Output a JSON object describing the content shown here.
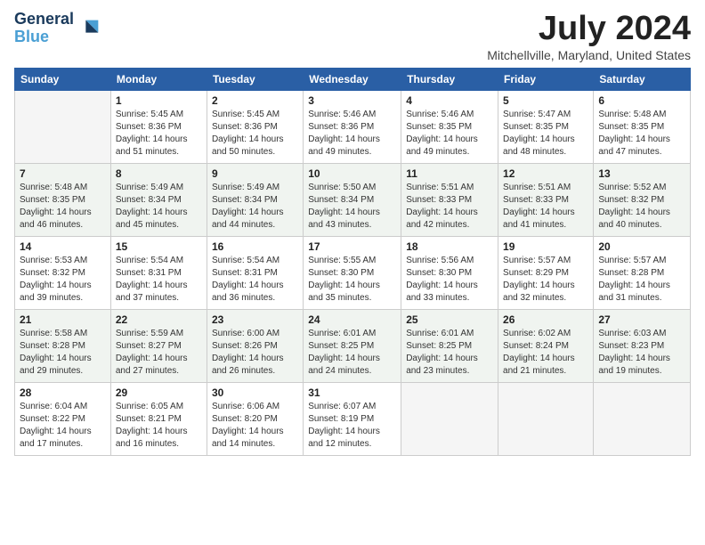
{
  "logo": {
    "line1": "General",
    "line2": "Blue"
  },
  "title": "July 2024",
  "location": "Mitchellville, Maryland, United States",
  "days_of_week": [
    "Sunday",
    "Monday",
    "Tuesday",
    "Wednesday",
    "Thursday",
    "Friday",
    "Saturday"
  ],
  "weeks": [
    [
      {
        "day": "",
        "info": ""
      },
      {
        "day": "1",
        "info": "Sunrise: 5:45 AM\nSunset: 8:36 PM\nDaylight: 14 hours\nand 51 minutes."
      },
      {
        "day": "2",
        "info": "Sunrise: 5:45 AM\nSunset: 8:36 PM\nDaylight: 14 hours\nand 50 minutes."
      },
      {
        "day": "3",
        "info": "Sunrise: 5:46 AM\nSunset: 8:36 PM\nDaylight: 14 hours\nand 49 minutes."
      },
      {
        "day": "4",
        "info": "Sunrise: 5:46 AM\nSunset: 8:35 PM\nDaylight: 14 hours\nand 49 minutes."
      },
      {
        "day": "5",
        "info": "Sunrise: 5:47 AM\nSunset: 8:35 PM\nDaylight: 14 hours\nand 48 minutes."
      },
      {
        "day": "6",
        "info": "Sunrise: 5:48 AM\nSunset: 8:35 PM\nDaylight: 14 hours\nand 47 minutes."
      }
    ],
    [
      {
        "day": "7",
        "info": "Sunrise: 5:48 AM\nSunset: 8:35 PM\nDaylight: 14 hours\nand 46 minutes."
      },
      {
        "day": "8",
        "info": "Sunrise: 5:49 AM\nSunset: 8:34 PM\nDaylight: 14 hours\nand 45 minutes."
      },
      {
        "day": "9",
        "info": "Sunrise: 5:49 AM\nSunset: 8:34 PM\nDaylight: 14 hours\nand 44 minutes."
      },
      {
        "day": "10",
        "info": "Sunrise: 5:50 AM\nSunset: 8:34 PM\nDaylight: 14 hours\nand 43 minutes."
      },
      {
        "day": "11",
        "info": "Sunrise: 5:51 AM\nSunset: 8:33 PM\nDaylight: 14 hours\nand 42 minutes."
      },
      {
        "day": "12",
        "info": "Sunrise: 5:51 AM\nSunset: 8:33 PM\nDaylight: 14 hours\nand 41 minutes."
      },
      {
        "day": "13",
        "info": "Sunrise: 5:52 AM\nSunset: 8:32 PM\nDaylight: 14 hours\nand 40 minutes."
      }
    ],
    [
      {
        "day": "14",
        "info": "Sunrise: 5:53 AM\nSunset: 8:32 PM\nDaylight: 14 hours\nand 39 minutes."
      },
      {
        "day": "15",
        "info": "Sunrise: 5:54 AM\nSunset: 8:31 PM\nDaylight: 14 hours\nand 37 minutes."
      },
      {
        "day": "16",
        "info": "Sunrise: 5:54 AM\nSunset: 8:31 PM\nDaylight: 14 hours\nand 36 minutes."
      },
      {
        "day": "17",
        "info": "Sunrise: 5:55 AM\nSunset: 8:30 PM\nDaylight: 14 hours\nand 35 minutes."
      },
      {
        "day": "18",
        "info": "Sunrise: 5:56 AM\nSunset: 8:30 PM\nDaylight: 14 hours\nand 33 minutes."
      },
      {
        "day": "19",
        "info": "Sunrise: 5:57 AM\nSunset: 8:29 PM\nDaylight: 14 hours\nand 32 minutes."
      },
      {
        "day": "20",
        "info": "Sunrise: 5:57 AM\nSunset: 8:28 PM\nDaylight: 14 hours\nand 31 minutes."
      }
    ],
    [
      {
        "day": "21",
        "info": "Sunrise: 5:58 AM\nSunset: 8:28 PM\nDaylight: 14 hours\nand 29 minutes."
      },
      {
        "day": "22",
        "info": "Sunrise: 5:59 AM\nSunset: 8:27 PM\nDaylight: 14 hours\nand 27 minutes."
      },
      {
        "day": "23",
        "info": "Sunrise: 6:00 AM\nSunset: 8:26 PM\nDaylight: 14 hours\nand 26 minutes."
      },
      {
        "day": "24",
        "info": "Sunrise: 6:01 AM\nSunset: 8:25 PM\nDaylight: 14 hours\nand 24 minutes."
      },
      {
        "day": "25",
        "info": "Sunrise: 6:01 AM\nSunset: 8:25 PM\nDaylight: 14 hours\nand 23 minutes."
      },
      {
        "day": "26",
        "info": "Sunrise: 6:02 AM\nSunset: 8:24 PM\nDaylight: 14 hours\nand 21 minutes."
      },
      {
        "day": "27",
        "info": "Sunrise: 6:03 AM\nSunset: 8:23 PM\nDaylight: 14 hours\nand 19 minutes."
      }
    ],
    [
      {
        "day": "28",
        "info": "Sunrise: 6:04 AM\nSunset: 8:22 PM\nDaylight: 14 hours\nand 17 minutes."
      },
      {
        "day": "29",
        "info": "Sunrise: 6:05 AM\nSunset: 8:21 PM\nDaylight: 14 hours\nand 16 minutes."
      },
      {
        "day": "30",
        "info": "Sunrise: 6:06 AM\nSunset: 8:20 PM\nDaylight: 14 hours\nand 14 minutes."
      },
      {
        "day": "31",
        "info": "Sunrise: 6:07 AM\nSunset: 8:19 PM\nDaylight: 14 hours\nand 12 minutes."
      },
      {
        "day": "",
        "info": ""
      },
      {
        "day": "",
        "info": ""
      },
      {
        "day": "",
        "info": ""
      }
    ]
  ]
}
